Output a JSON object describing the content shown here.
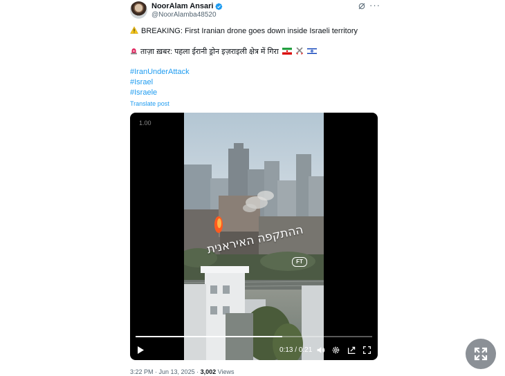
{
  "author": {
    "name": "NoorAlam Ansari",
    "handle": "@NoorAlamba48520",
    "verified": true,
    "verified_color": "#1d9bf0"
  },
  "tweet": {
    "line1_icon": "warning-icon",
    "line1": "BREAKING: First Iranian drone goes down inside Israeli territory",
    "line2_icon": "siren-icon",
    "line2": "ताज़ा ख़बर: पहला ईरानी ड्रोन इज़राइली क्षेत्र में गिरा",
    "line2_flags": [
      "iran-flag",
      "crossed-swords",
      "israel-flag"
    ],
    "hashtags": [
      "#IranUnderAttack",
      "#Israel",
      "#Israele"
    ],
    "translate_label": "Translate post"
  },
  "video": {
    "speed_label": "1.00",
    "overlay_text": "ההתקפה האיראנית",
    "watermark": "FT",
    "current_time": "0:13",
    "duration": "0:21",
    "progress": 0.62,
    "time_display": "0:13 / 0:21",
    "controls": [
      "play-icon",
      "volume-icon",
      "settings-icon",
      "pip-icon",
      "fullscreen-icon"
    ]
  },
  "meta": {
    "time": "3:22 PM",
    "date": "Jun 13, 2025",
    "views_count": "3,002",
    "views_label": "Views"
  },
  "colors": {
    "link": "#1d9bf0",
    "secondary_text": "#536471",
    "primary_text": "#0f1419",
    "expand_button": "#8b9096"
  }
}
